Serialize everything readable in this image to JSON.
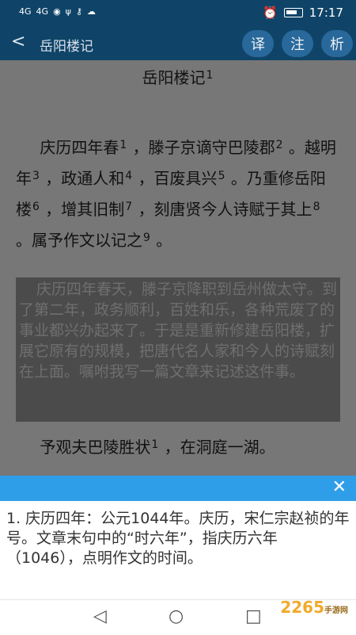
{
  "status": {
    "signal1": "4G",
    "signal2": "4G",
    "time": "17:17"
  },
  "toolbar": {
    "title": "岳阳楼记",
    "translate": "译",
    "annotate": "注",
    "analyze": "析"
  },
  "article": {
    "title": "岳阳楼记",
    "title_ref": "1",
    "paragraph1": [
      {
        "text": "庆历四年春",
        "ref": "1"
      },
      {
        "text": "，滕子京谪守巴陵郡",
        "ref": "2"
      },
      {
        "text": "。越明年",
        "ref": "3"
      },
      {
        "text": "，政通人和",
        "ref": "4"
      },
      {
        "text": "，百废具兴",
        "ref": "5"
      },
      {
        "text": "。乃重修岳阳楼",
        "ref": "6"
      },
      {
        "text": "，增其旧制",
        "ref": "7"
      },
      {
        "text": "，刻唐贤今人诗赋于其上",
        "ref": "8"
      },
      {
        "text": "。属予作文以记之",
        "ref": "9"
      },
      {
        "text": "。"
      }
    ],
    "translation": "庆历四年春天，滕子京降职到岳州做太守。到了第二年，政务顺利，百姓和乐，各种荒废了的事业都兴办起来了。于是是重新修建岳阳楼，扩展它原有的规模，把唐代名人家和今人的诗赋刻在上面。嘱咐我写一篇文章来记述这件事。",
    "paragraph2": [
      {
        "text": "予观夫巴陵胜状",
        "ref": "1"
      },
      {
        "text": "，在洞庭一湖。"
      }
    ]
  },
  "note": {
    "text": "1. 庆历四年：公元1044年。庆历，宋仁宗赵祯的年号。文章末句中的“时六年”，指庆历六年（1046），点明作文的时间。"
  },
  "watermark": {
    "brand": "2265",
    "sub": "手游网"
  }
}
